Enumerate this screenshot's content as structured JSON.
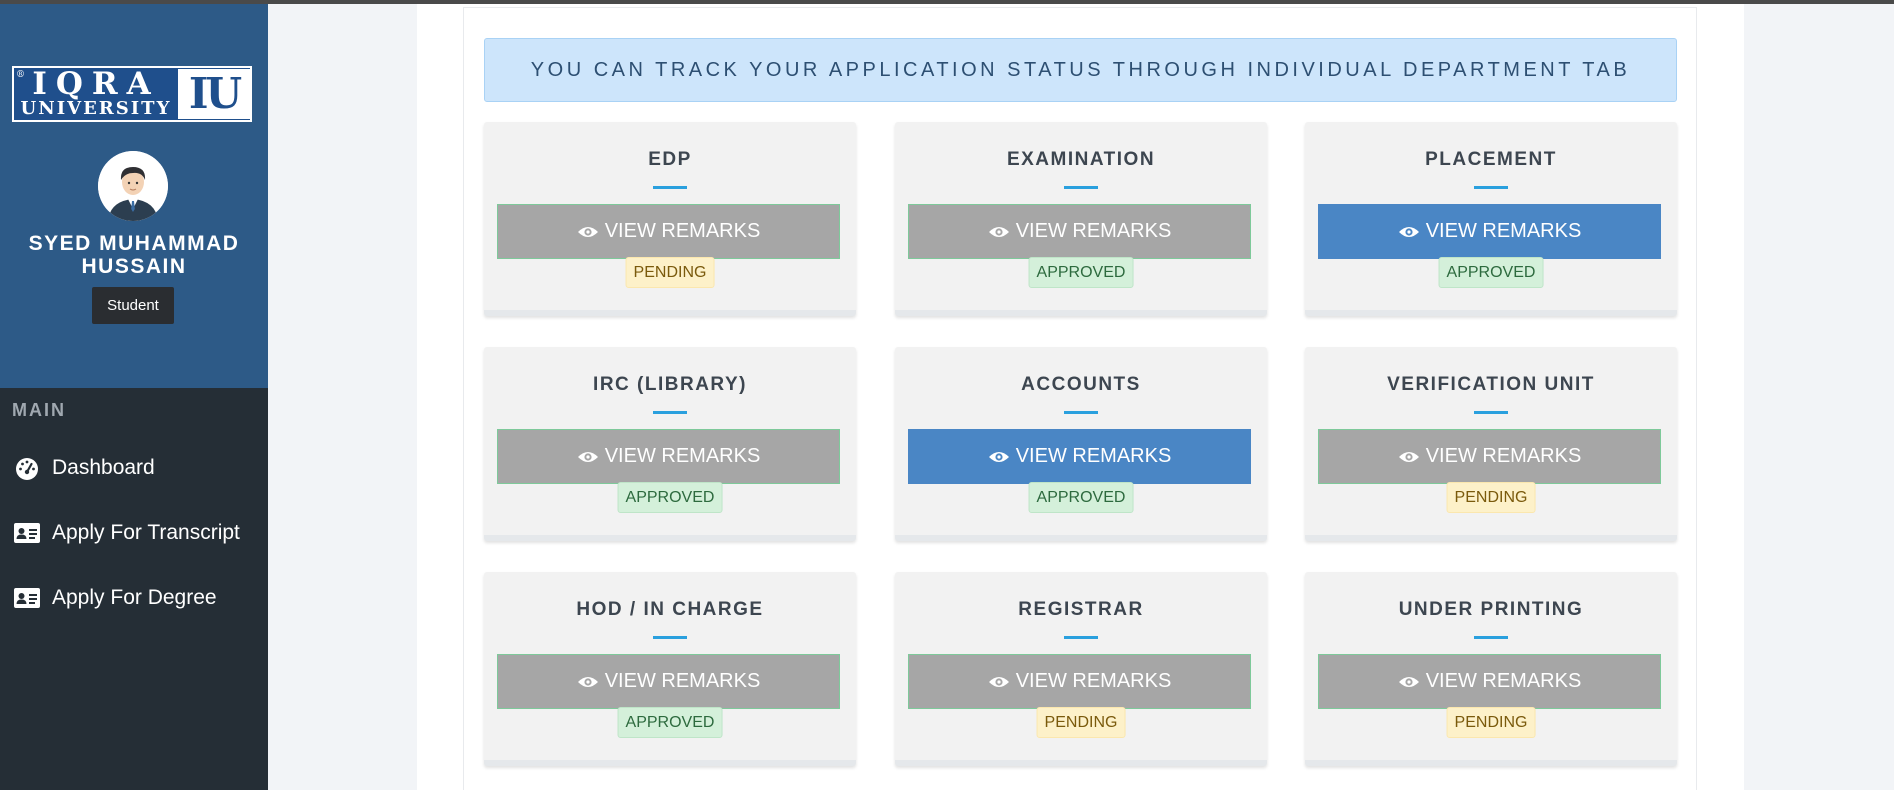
{
  "logo": {
    "main": "IQRA",
    "sub": "UNIVERSITY",
    "mark": "IU",
    "reg": "®"
  },
  "user": {
    "name": "SYED MUHAMMAD HUSSAIN",
    "role": "Student"
  },
  "nav": {
    "heading": "MAIN",
    "items": [
      {
        "label": "Dashboard",
        "icon": "dashboard-gauge-icon"
      },
      {
        "label": "Apply For Transcript",
        "icon": "id-card-icon"
      },
      {
        "label": "Apply For Degree",
        "icon": "id-card-icon"
      }
    ]
  },
  "banner": "YOU CAN TRACK YOUR APPLICATION STATUS THROUGH INDIVIDUAL DEPARTMENT TAB",
  "colors": {
    "sidebar_top": "#2d5a87",
    "sidebar_bottom": "#252e36",
    "button_gray": "#a6a6a6",
    "button_blue": "#4a86c5",
    "underline": "#2aa0de"
  },
  "departments": [
    {
      "title": "EDP",
      "button": "VIEW REMARKS",
      "status": "PENDING",
      "active": false
    },
    {
      "title": "EXAMINATION",
      "button": "VIEW REMARKS",
      "status": "APPROVED",
      "active": false
    },
    {
      "title": "PLACEMENT",
      "button": "VIEW REMARKS",
      "status": "APPROVED",
      "active": true
    },
    {
      "title": "IRC (LIBRARY)",
      "button": "VIEW REMARKS",
      "status": "APPROVED",
      "active": false
    },
    {
      "title": "ACCOUNTS",
      "button": "VIEW REMARKS",
      "status": "APPROVED",
      "active": true
    },
    {
      "title": "VERIFICATION UNIT",
      "button": "VIEW REMARKS",
      "status": "PENDING",
      "active": false
    },
    {
      "title": "HOD / IN CHARGE",
      "button": "VIEW REMARKS",
      "status": "APPROVED",
      "active": false
    },
    {
      "title": "REGISTRAR",
      "button": "VIEW REMARKS",
      "status": "PENDING",
      "active": false
    },
    {
      "title": "UNDER PRINTING",
      "button": "VIEW REMARKS",
      "status": "PENDING",
      "active": false
    }
  ]
}
